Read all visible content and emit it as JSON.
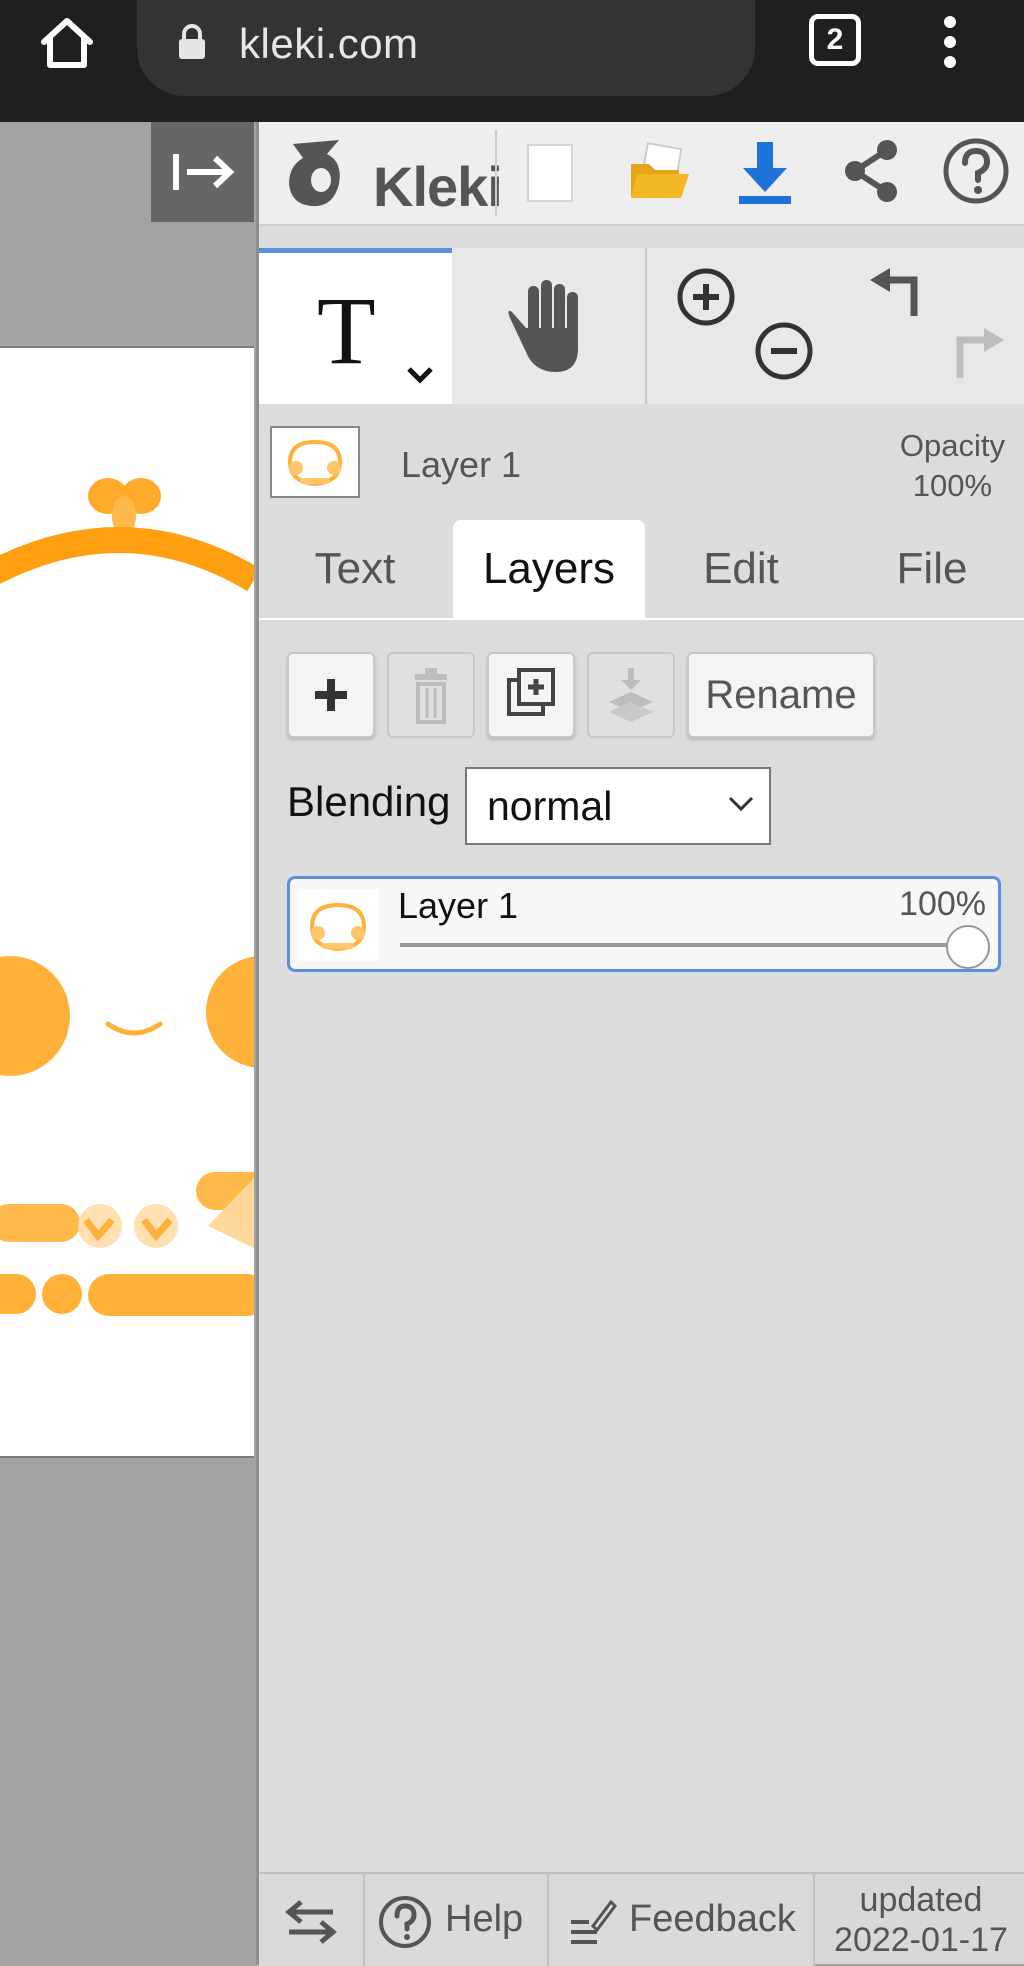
{
  "browser": {
    "url": "kleki.com",
    "tab_count": "2",
    "icons": [
      "home-icon",
      "lock-icon",
      "tabs-icon",
      "more-vertical-icon"
    ]
  },
  "toolbar": {
    "logo_text": "Kleki",
    "icons": [
      "collapse-panel-icon",
      "new-image-icon",
      "open-folder-icon",
      "download-icon",
      "share-icon",
      "help-icon"
    ],
    "colors": {
      "download": "#1e73d8",
      "folder": "#f2b824"
    }
  },
  "tools": {
    "text_tool_glyph": "T",
    "icons": [
      "text-tool-icon",
      "chevron-down-icon",
      "hand-icon",
      "zoom-in-icon",
      "zoom-out-icon",
      "undo-icon",
      "redo-icon"
    ]
  },
  "layer_info": {
    "name": "Layer 1",
    "opacity_label": "Opacity",
    "opacity_value": "100%"
  },
  "tabs": [
    {
      "label": "Text",
      "active": false
    },
    {
      "label": "Layers",
      "active": true
    },
    {
      "label": "Edit",
      "active": false
    },
    {
      "label": "File",
      "active": false
    }
  ],
  "layers_panel": {
    "buttons": {
      "rename_label": "Rename",
      "icons": [
        "add-layer-icon",
        "delete-layer-icon",
        "duplicate-layer-icon",
        "merge-down-icon"
      ]
    },
    "blending": {
      "label": "Blending",
      "value": "normal"
    },
    "layers": [
      {
        "name": "Layer 1",
        "opacity": "100%",
        "opacity_fraction": 1.0,
        "selected": true
      }
    ]
  },
  "footer": {
    "help_label": "Help",
    "feedback_label": "Feedback",
    "updated_label": "updated",
    "updated_date": "2022-01-17",
    "icons": [
      "swap-icon",
      "help-circle-icon",
      "feedback-icon"
    ]
  },
  "accent_color": "#5b8fe0"
}
